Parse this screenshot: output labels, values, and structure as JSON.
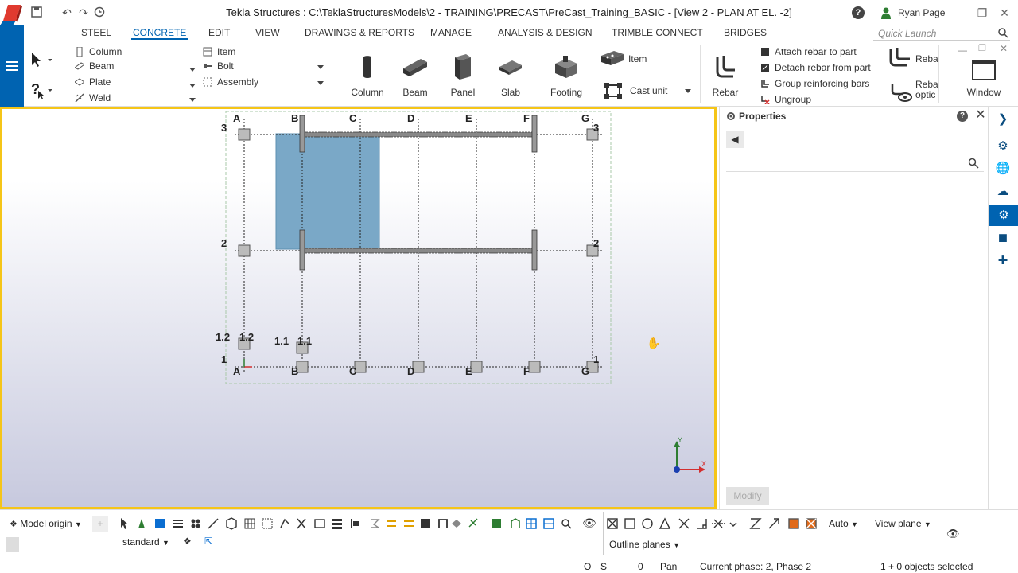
{
  "window": {
    "title": "Tekla Structures : C:\\TeklaStructuresModels\\2 - TRAINING\\PRECAST\\PreCast_Training_BASIC - [View 2 - PLAN AT EL. -2]",
    "user": "Ryan Page",
    "quick_launch_placeholder": "Quick Launch"
  },
  "ribbon": {
    "tabs": [
      "STEEL",
      "CONCRETE",
      "EDIT",
      "VIEW",
      "DRAWINGS & REPORTS",
      "MANAGE",
      "ANALYSIS & DESIGN",
      "TRIMBLE CONNECT",
      "BRIDGES"
    ],
    "active_tab": "CONCRETE",
    "steel_items": [
      "Column",
      "Beam",
      "Plate",
      "Weld"
    ],
    "misc_items": [
      "Item",
      "Bolt",
      "Assembly"
    ],
    "big_buttons": [
      "Column",
      "Beam",
      "Panel",
      "Slab",
      "Footing"
    ],
    "item_label": "Item",
    "cast_unit_label": "Cast unit",
    "rebar_label": "Rebar",
    "rebar_actions": [
      "Attach rebar to part",
      "Detach rebar from part",
      "Group reinforcing bars",
      "Ungroup"
    ],
    "rebar_short": "Reba",
    "rebar_options": [
      "Reba",
      "optic"
    ],
    "window_label": "Window"
  },
  "view": {
    "grid_columns": [
      "A",
      "B",
      "C",
      "D",
      "E",
      "F",
      "G"
    ],
    "grid_rows_left": [
      "3",
      "2",
      "1"
    ],
    "grid_rows_right": [
      "3",
      "2",
      "1"
    ],
    "extra_labels": [
      "1.2",
      "1.2",
      "1.1",
      "1.1"
    ],
    "axis_x": "X",
    "axis_y": "Y"
  },
  "properties": {
    "title": "Properties",
    "modify_label": "Modify"
  },
  "bottom": {
    "model_origin": "Model origin",
    "standard": "standard",
    "auto": "Auto",
    "view_plane": "View plane",
    "outline_planes": "Outline planes"
  },
  "status": {
    "o": "O",
    "s": "S",
    "zero": "0",
    "pan": "Pan",
    "phase": "Current phase: 2, Phase 2",
    "selected": "1 + 0 objects selected"
  },
  "colors": {
    "accent": "#0063b1",
    "viewport_border": "#f5c518",
    "slab_fill": "#7aa8c7",
    "logo_red": "#e03a2f"
  }
}
